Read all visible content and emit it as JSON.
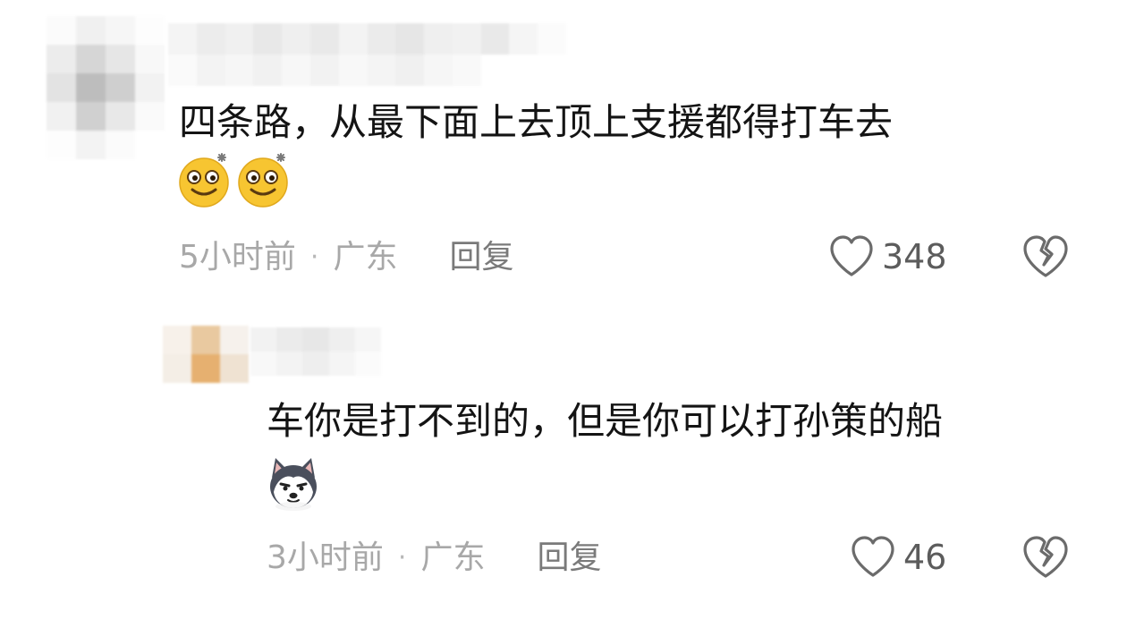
{
  "comments": [
    {
      "text": "四条路，从最下面上去顶上支援都得打车去",
      "emojis": [
        "dizzy-smile-emoji",
        "dizzy-smile-emoji"
      ],
      "time": "5小时前",
      "dot": "·",
      "location": "广东",
      "reply_label": "回复",
      "likes": "348"
    },
    {
      "text": "车你是打不到的，但是你可以打孙策的船",
      "emojis": [
        "husky-dog-emoji"
      ],
      "time": "3小时前",
      "dot": "·",
      "location": "广东",
      "reply_label": "回复",
      "likes": "46"
    }
  ],
  "colors": {
    "text": "#141414",
    "meta": "#a8a8a8",
    "reply": "#7a7a7a",
    "icon": "#6b6b6b",
    "emoji_yellow": "#f7c531"
  }
}
